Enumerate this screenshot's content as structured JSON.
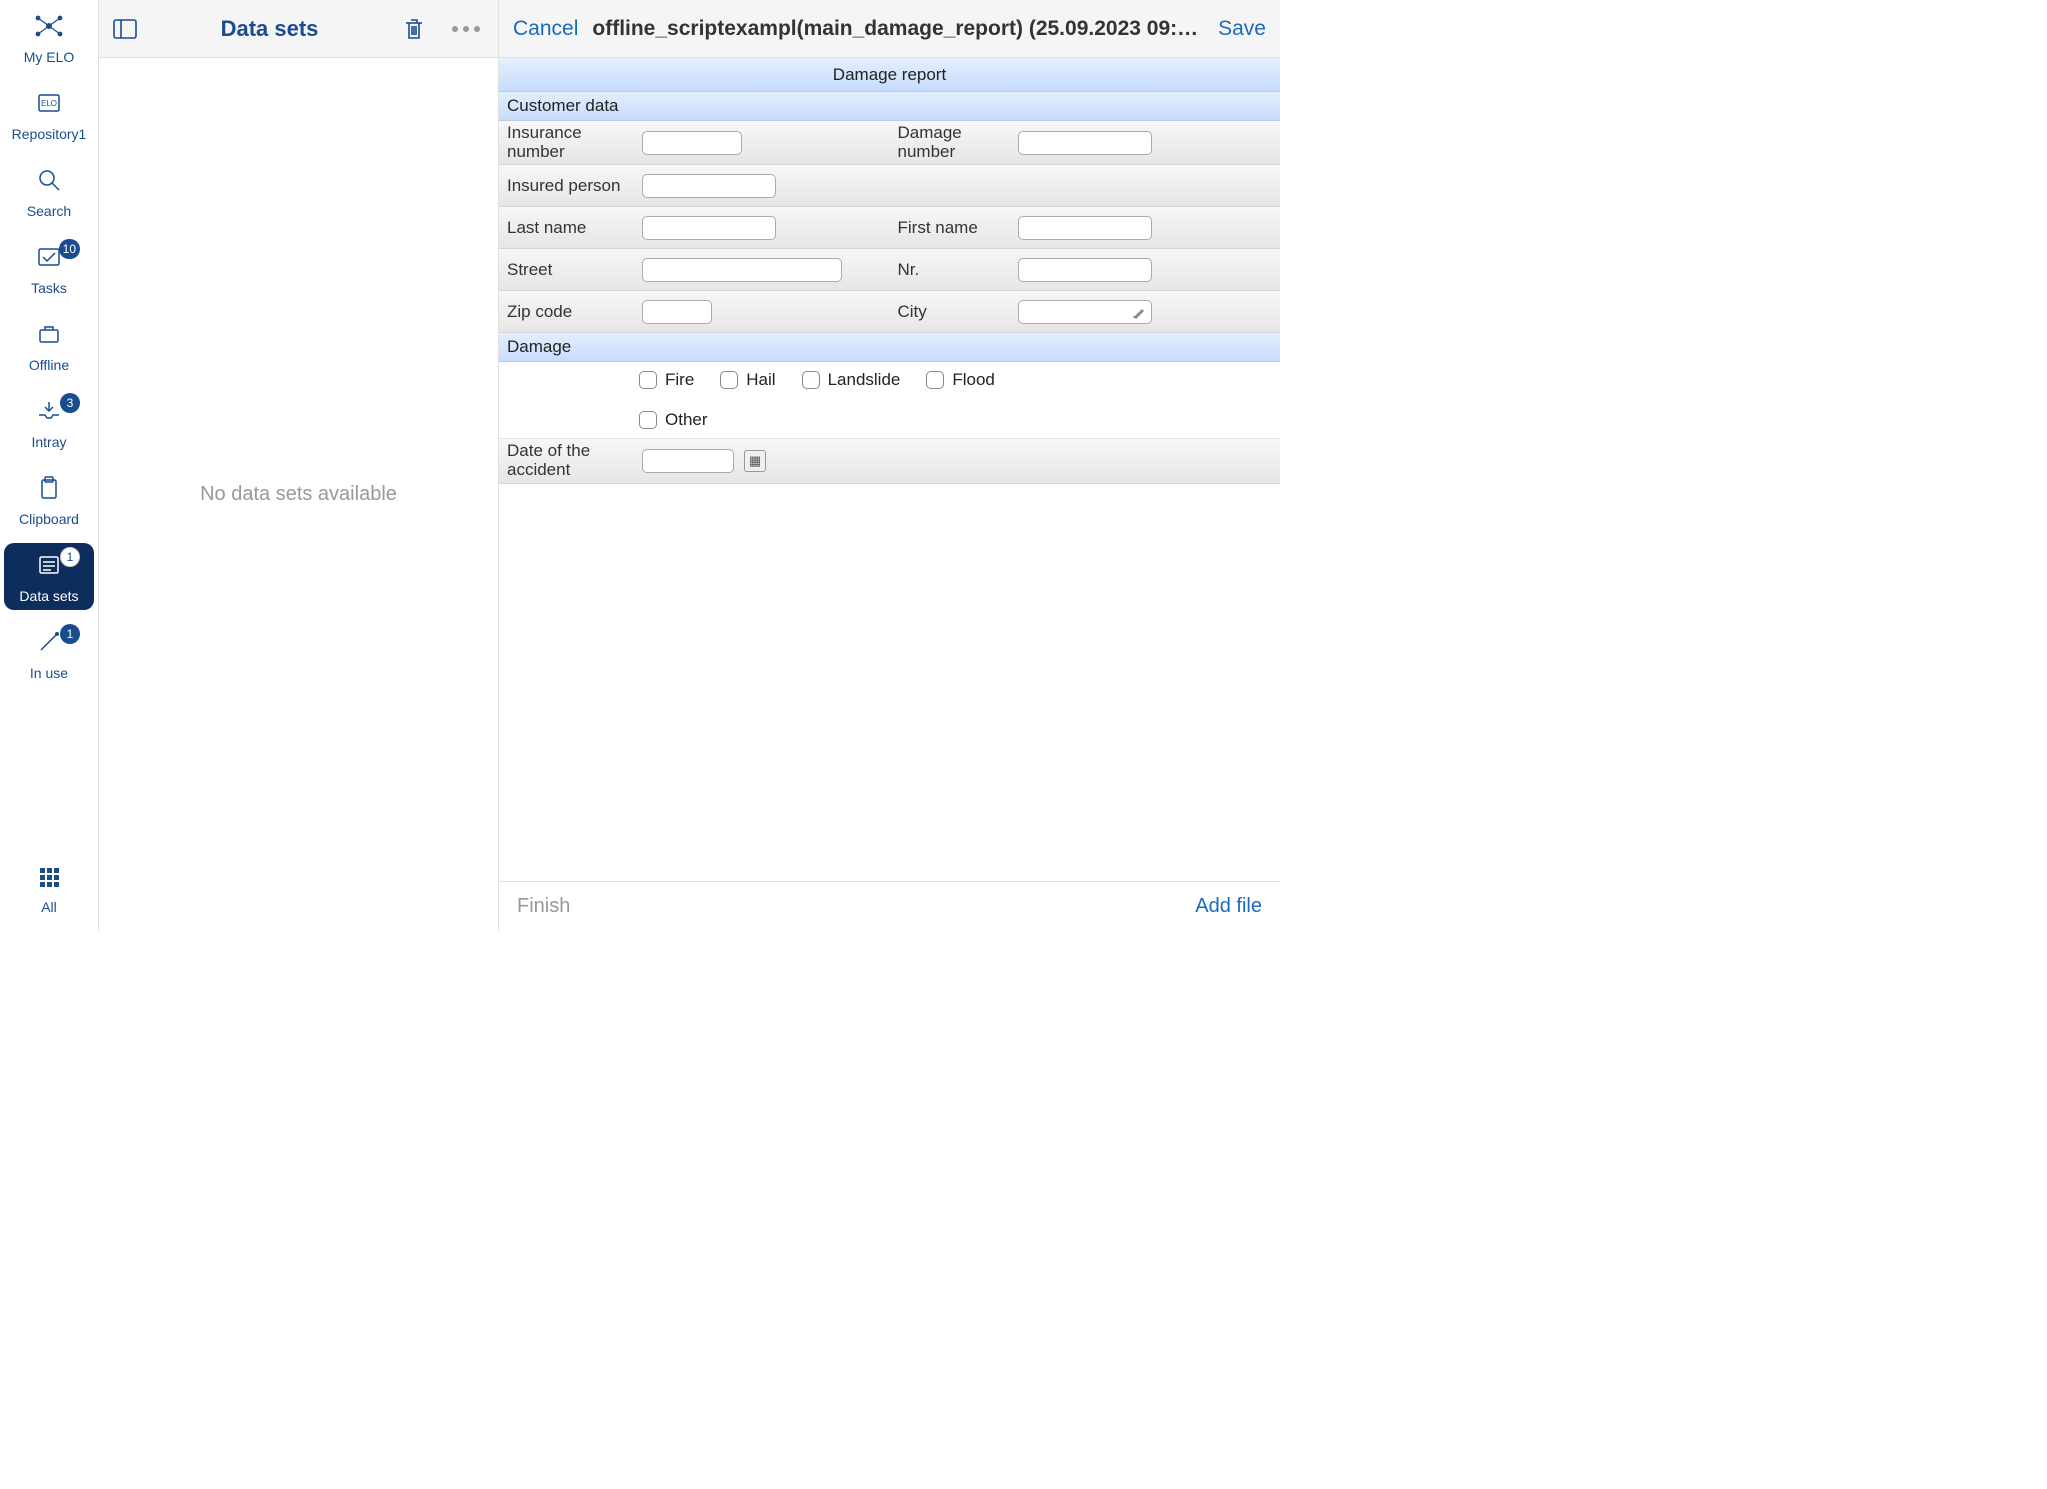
{
  "nav": {
    "items": [
      {
        "label": "My ELO",
        "badge": null
      },
      {
        "label": "Repository1",
        "badge": null
      },
      {
        "label": "Search",
        "badge": null
      },
      {
        "label": "Tasks",
        "badge": "10"
      },
      {
        "label": "Offline",
        "badge": null
      },
      {
        "label": "Intray",
        "badge": "3"
      },
      {
        "label": "Clipboard",
        "badge": null
      },
      {
        "label": "Data sets",
        "badge": "1"
      },
      {
        "label": "In use",
        "badge": "1"
      }
    ],
    "bottom": {
      "label": "All"
    }
  },
  "list": {
    "title": "Data sets",
    "empty_text": "No data sets available"
  },
  "detail": {
    "cancel": "Cancel",
    "save": "Save",
    "title": "offline_scriptexampl(main_damage_report) (25.09.2023 09:…",
    "footer_finish": "Finish",
    "footer_addfile": "Add file"
  },
  "form": {
    "title": "Damage report",
    "sections": {
      "customer": {
        "heading": "Customer data",
        "fields": {
          "insurance_number": {
            "label": "Insurance number",
            "value": ""
          },
          "damage_number": {
            "label": "Damage number",
            "value": ""
          },
          "insured_person": {
            "label": "Insured person",
            "value": ""
          },
          "last_name": {
            "label": "Last name",
            "value": ""
          },
          "first_name": {
            "label": "First name",
            "value": ""
          },
          "street": {
            "label": "Street",
            "value": ""
          },
          "nr": {
            "label": "Nr.",
            "value": ""
          },
          "zip": {
            "label": "Zip code",
            "value": ""
          },
          "city": {
            "label": "City",
            "value": ""
          }
        }
      },
      "damage": {
        "heading": "Damage",
        "options": [
          "Fire",
          "Hail",
          "Landslide",
          "Flood",
          "Other"
        ],
        "date_label": "Date of the accident",
        "date_value": ""
      }
    }
  }
}
